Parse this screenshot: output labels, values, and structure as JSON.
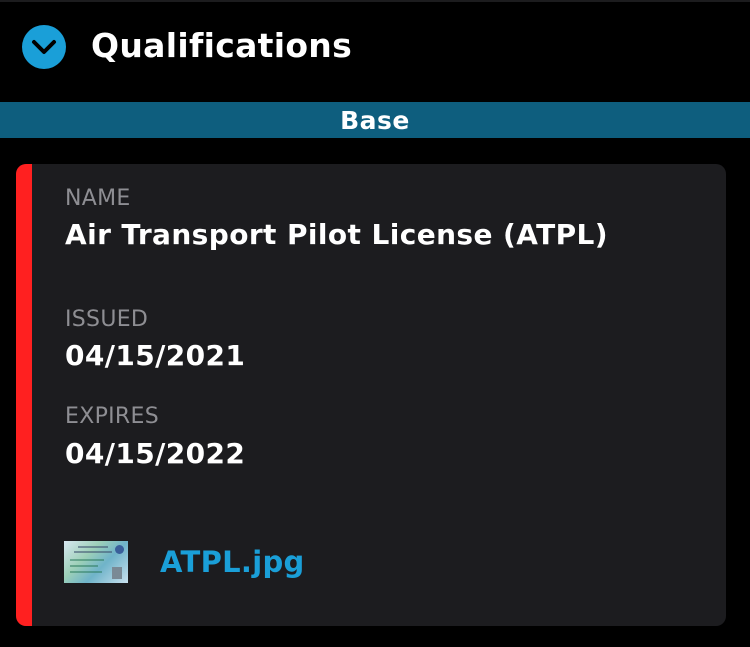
{
  "header": {
    "title": "Qualifications",
    "expand_icon": "chevron-down-icon",
    "accent_color": "#1a9fd8"
  },
  "section": {
    "title": "Base",
    "color": "#0e5e7e"
  },
  "qualification": {
    "status_color": "#ff2020",
    "name_label": "NAME",
    "name_value": "Air Transport Pilot License (ATPL)",
    "issued_label": "ISSUED",
    "issued_value": "04/15/2021",
    "expires_label": "EXPIRES",
    "expires_value": "04/15/2022",
    "attachment": {
      "file_name": "ATPL.jpg",
      "thumbnail_icon": "license-image-thumbnail"
    }
  }
}
